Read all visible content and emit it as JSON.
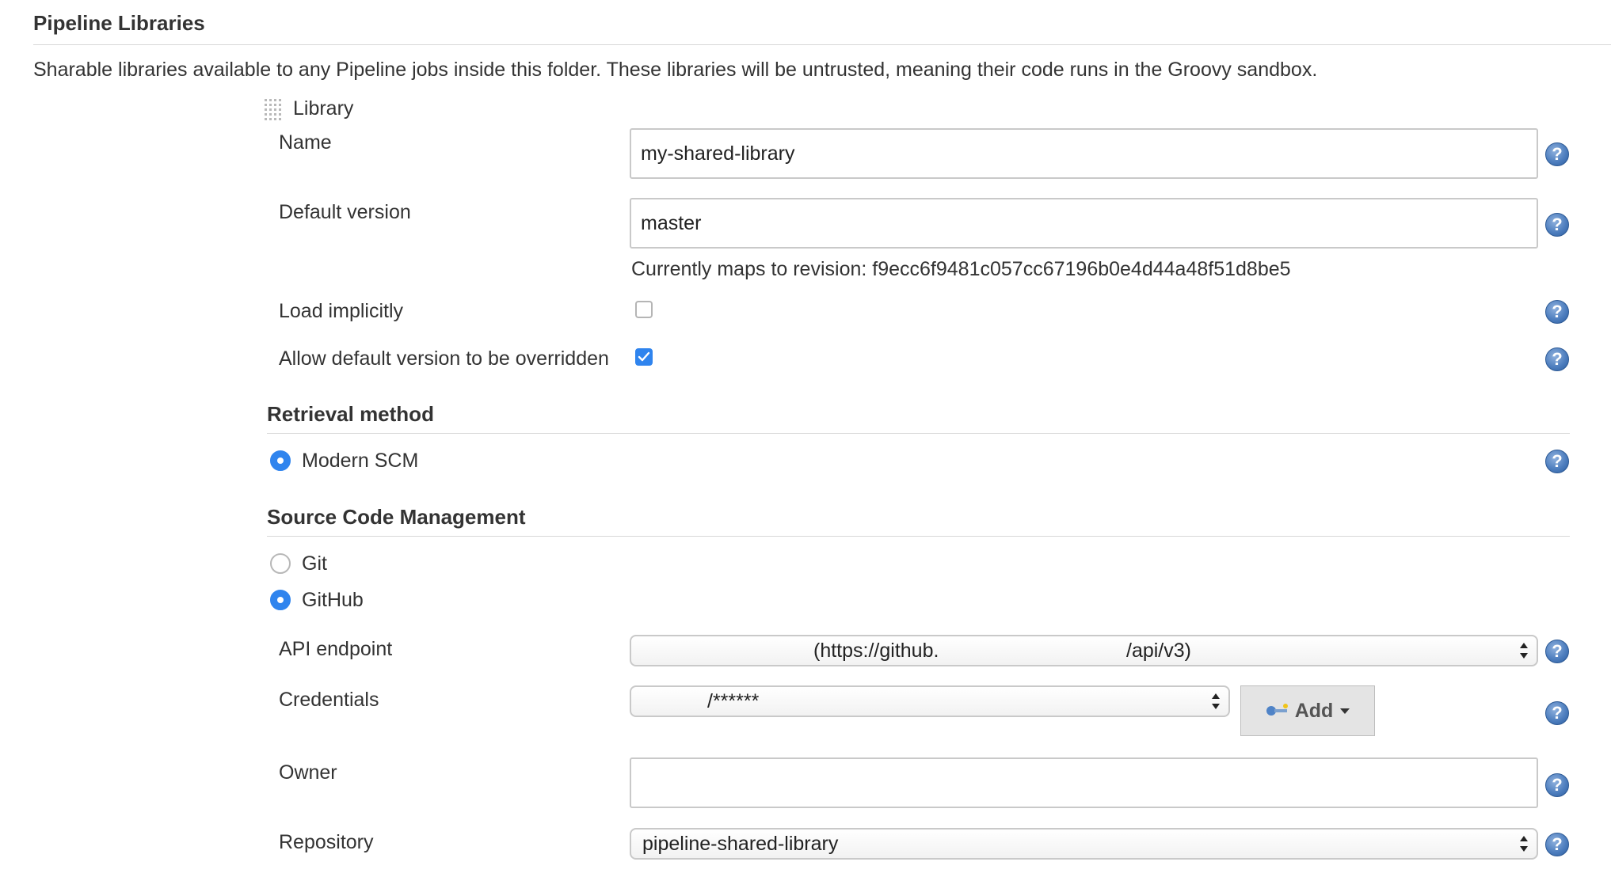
{
  "section": {
    "title": "Pipeline Libraries",
    "description": "Sharable libraries available to any Pipeline jobs inside this folder. These libraries will be untrusted, meaning their code runs in the Groovy sandbox."
  },
  "library": {
    "header": "Library",
    "name": {
      "label": "Name",
      "value": "my-shared-library"
    },
    "default_version": {
      "label": "Default version",
      "value": "master"
    },
    "revision_note": "Currently maps to revision: f9ecc6f9481c057cc67196b0e4d44a48f51d8be5",
    "load_implicitly": {
      "label": "Load implicitly",
      "checked": false
    },
    "allow_override": {
      "label": "Allow default version to be overridden",
      "checked": true
    }
  },
  "retrieval": {
    "title": "Retrieval method",
    "option": "Modern SCM"
  },
  "scm": {
    "title": "Source Code Management",
    "options": [
      "Git",
      "GitHub"
    ],
    "selected": "GitHub",
    "api_endpoint": {
      "label": "API endpoint",
      "value_start": "(https://github.",
      "value_end": "/api/v3)"
    },
    "credentials": {
      "label": "Credentials",
      "value_end": "/******",
      "add_label": "Add"
    },
    "owner": {
      "label": "Owner",
      "value": ""
    },
    "repository": {
      "label": "Repository",
      "value": "pipeline-shared-library"
    }
  },
  "help_symbol": "?",
  "colors": {
    "accent": "#2f84ee",
    "help_icon": "#4f7fbf"
  }
}
